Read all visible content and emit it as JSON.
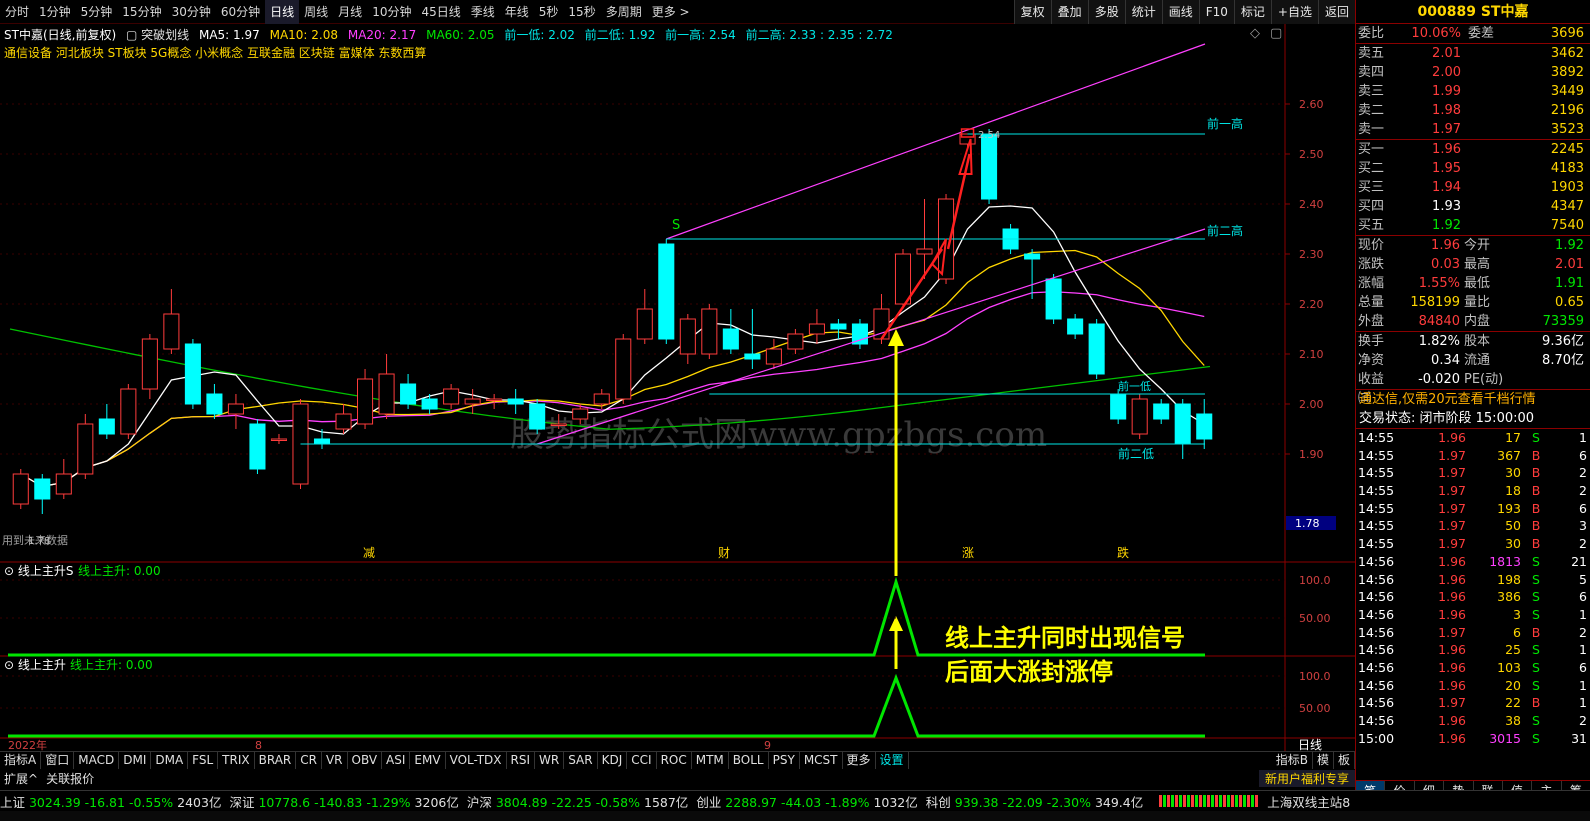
{
  "toolbar": {
    "periods": [
      "分时",
      "1分钟",
      "5分钟",
      "15分钟",
      "30分钟",
      "60分钟",
      "日线",
      "周线",
      "月线",
      "10分钟",
      "45日线",
      "季线",
      "年线",
      "5秒",
      "15秒",
      "多周期",
      "更多 >"
    ],
    "tools": [
      "复权",
      "叠加",
      "多股",
      "统计",
      "画线",
      "F10",
      "标记",
      "+自选",
      "返回"
    ]
  },
  "chart": {
    "header": {
      "name": "ST中嘉(日线,前复权)",
      "indicator": "突破划线",
      "ma5": "MA5: 1.97",
      "ma10": "MA10: 2.08",
      "ma20": "MA20: 2.17",
      "ma60": "MA60: 2.05",
      "ql1": "前一低: 2.02",
      "ql2": "前二低: 1.92",
      "qh1": "前一高: 2.54",
      "qh2": "前二高: 2.33 : 2.35 : 2.72"
    },
    "concepts": "通信设备 河北板块 ST板块 5G概念 小米概念 互联金融 区块链 富媒体 东数西算",
    "y_ticks": [
      "2.60",
      "2.50",
      "2.40",
      "2.30",
      "2.20",
      "2.10",
      "2.00",
      "1.90"
    ],
    "current_price_tag": "1.78",
    "line_labels": {
      "qh1": "前一高",
      "qh2": "前二高",
      "ql1": "前一低",
      "ql2": "前二低",
      "high_mark": "2.54",
      "low_mark": "1.78",
      "s_mark": "S"
    },
    "footnote": "用到未来数据",
    "markers": [
      "减",
      "财",
      "涨",
      "跌"
    ],
    "watermark": "股势指标公式网www.gpzbgs.com",
    "annotation_line1": "线上主升同时出现信号",
    "annotation_line2": "后面大涨封涨停",
    "sub1": {
      "title": "线上主升S",
      "value": "线上主升: 0.00",
      "ticks": [
        "100.0",
        "50.00"
      ]
    },
    "sub2": {
      "title": "线上主升",
      "value": "线上主升: 0.00",
      "ticks": [
        "100.0",
        "50.00"
      ]
    },
    "x_labels": [
      "2022年",
      "8",
      "9"
    ],
    "period_label": "日线"
  },
  "chart_data": {
    "type": "candlestick",
    "ylim": [
      1.78,
      2.72
    ],
    "candles": [
      {
        "o": 1.8,
        "c": 1.86,
        "h": 1.87,
        "l": 1.79
      },
      {
        "o": 1.85,
        "c": 1.81,
        "h": 1.86,
        "l": 1.78
      },
      {
        "o": 1.82,
        "c": 1.86,
        "h": 1.89,
        "l": 1.81
      },
      {
        "o": 1.86,
        "c": 1.96,
        "h": 1.98,
        "l": 1.85
      },
      {
        "o": 1.97,
        "c": 1.94,
        "h": 2.0,
        "l": 1.93
      },
      {
        "o": 1.94,
        "c": 2.03,
        "h": 2.04,
        "l": 1.93
      },
      {
        "o": 2.03,
        "c": 2.13,
        "h": 2.14,
        "l": 2.01
      },
      {
        "o": 2.11,
        "c": 2.18,
        "h": 2.23,
        "l": 2.1
      },
      {
        "o": 2.12,
        "c": 2.0,
        "h": 2.13,
        "l": 1.99
      },
      {
        "o": 2.02,
        "c": 1.98,
        "h": 2.04,
        "l": 1.97
      },
      {
        "o": 1.98,
        "c": 2.0,
        "h": 2.02,
        "l": 1.95
      },
      {
        "o": 1.96,
        "c": 1.87,
        "h": 1.97,
        "l": 1.86
      },
      {
        "o": 1.93,
        "c": 1.93,
        "h": 1.94,
        "l": 1.92
      },
      {
        "o": 1.84,
        "c": 2.0,
        "h": 2.01,
        "l": 1.83
      },
      {
        "o": 1.93,
        "c": 1.92,
        "h": 1.95,
        "l": 1.91
      },
      {
        "o": 1.95,
        "c": 1.98,
        "h": 2.0,
        "l": 1.94
      },
      {
        "o": 1.96,
        "c": 2.05,
        "h": 2.07,
        "l": 1.95
      },
      {
        "o": 1.98,
        "c": 2.06,
        "h": 2.1,
        "l": 1.97
      },
      {
        "o": 2.04,
        "c": 2.0,
        "h": 2.06,
        "l": 1.99
      },
      {
        "o": 2.01,
        "c": 1.99,
        "h": 2.02,
        "l": 1.98
      },
      {
        "o": 2.0,
        "c": 2.03,
        "h": 2.04,
        "l": 1.99
      },
      {
        "o": 2.0,
        "c": 2.01,
        "h": 2.03,
        "l": 1.98
      },
      {
        "o": 2.01,
        "c": 2.01,
        "h": 2.02,
        "l": 1.99
      },
      {
        "o": 2.01,
        "c": 2.0,
        "h": 2.03,
        "l": 1.98
      },
      {
        "o": 2.0,
        "c": 1.95,
        "h": 2.01,
        "l": 1.94
      },
      {
        "o": 1.96,
        "c": 1.96,
        "h": 1.98,
        "l": 1.95
      },
      {
        "o": 1.97,
        "c": 1.99,
        "h": 2.0,
        "l": 1.96
      },
      {
        "o": 2.0,
        "c": 2.02,
        "h": 2.03,
        "l": 1.99
      },
      {
        "o": 2.01,
        "c": 2.13,
        "h": 2.14,
        "l": 2.0
      },
      {
        "o": 2.13,
        "c": 2.19,
        "h": 2.23,
        "l": 2.12
      },
      {
        "o": 2.32,
        "c": 2.13,
        "h": 2.33,
        "l": 2.12
      },
      {
        "o": 2.1,
        "c": 2.17,
        "h": 2.18,
        "l": 2.08
      },
      {
        "o": 2.1,
        "c": 2.19,
        "h": 2.2,
        "l": 2.09
      },
      {
        "o": 2.15,
        "c": 2.11,
        "h": 2.19,
        "l": 2.1
      },
      {
        "o": 2.1,
        "c": 2.09,
        "h": 2.19,
        "l": 2.07
      },
      {
        "o": 2.08,
        "c": 2.11,
        "h": 2.13,
        "l": 2.07
      },
      {
        "o": 2.11,
        "c": 2.14,
        "h": 2.15,
        "l": 2.1
      },
      {
        "o": 2.14,
        "c": 2.16,
        "h": 2.19,
        "l": 2.12
      },
      {
        "o": 2.16,
        "c": 2.15,
        "h": 2.17,
        "l": 2.13
      },
      {
        "o": 2.16,
        "c": 2.12,
        "h": 2.17,
        "l": 2.11
      },
      {
        "o": 2.13,
        "c": 2.19,
        "h": 2.22,
        "l": 2.12
      },
      {
        "o": 2.2,
        "c": 2.3,
        "h": 2.31,
        "l": 2.19
      },
      {
        "o": 2.3,
        "c": 2.31,
        "h": 2.41,
        "l": 2.25
      },
      {
        "o": 2.25,
        "c": 2.41,
        "h": 2.42,
        "l": 2.24
      },
      {
        "o": 2.52,
        "c": 2.54,
        "h": 2.54,
        "l": 2.51
      },
      {
        "o": 2.54,
        "c": 2.41,
        "h": 2.55,
        "l": 2.4
      },
      {
        "o": 2.35,
        "c": 2.31,
        "h": 2.36,
        "l": 2.3
      },
      {
        "o": 2.3,
        "c": 2.29,
        "h": 2.31,
        "l": 2.21
      },
      {
        "o": 2.25,
        "c": 2.17,
        "h": 2.26,
        "l": 2.16
      },
      {
        "o": 2.17,
        "c": 2.14,
        "h": 2.18,
        "l": 2.13
      },
      {
        "o": 2.16,
        "c": 2.06,
        "h": 2.17,
        "l": 2.05
      },
      {
        "o": 2.02,
        "c": 1.97,
        "h": 2.03,
        "l": 1.96
      },
      {
        "o": 1.94,
        "c": 2.01,
        "h": 2.02,
        "l": 1.93
      },
      {
        "o": 2.0,
        "c": 1.97,
        "h": 2.01,
        "l": 1.96
      },
      {
        "o": 2.0,
        "c": 1.92,
        "h": 2.01,
        "l": 1.89
      },
      {
        "o": 1.98,
        "c": 1.93,
        "h": 2.01,
        "l": 1.91
      }
    ]
  },
  "quote": {
    "code": "000889",
    "name": "ST中嘉",
    "weibi_label": "委比",
    "weibi": "10.06%",
    "weicha_label": "委差",
    "weicha": "3696",
    "asks": [
      {
        "label": "卖五",
        "price": "2.01",
        "vol": "3462"
      },
      {
        "label": "卖四",
        "price": "2.00",
        "vol": "3892"
      },
      {
        "label": "卖三",
        "price": "1.99",
        "vol": "3449"
      },
      {
        "label": "卖二",
        "price": "1.98",
        "vol": "2196"
      },
      {
        "label": "卖一",
        "price": "1.97",
        "vol": "3523"
      }
    ],
    "bids": [
      {
        "label": "买一",
        "price": "1.96",
        "vol": "2245"
      },
      {
        "label": "买二",
        "price": "1.95",
        "vol": "4183"
      },
      {
        "label": "买三",
        "price": "1.94",
        "vol": "1903"
      },
      {
        "label": "买四",
        "price": "1.93",
        "vol": "4347"
      },
      {
        "label": "买五",
        "price": "1.92",
        "vol": "7540"
      }
    ],
    "fields1": [
      {
        "l": "现价",
        "a": "1.96",
        "l2": "今开",
        "b": "1.92"
      },
      {
        "l": "涨跌",
        "a": "0.03",
        "l2": "最高",
        "b": "2.01"
      },
      {
        "l": "涨幅",
        "a": "1.55%",
        "l2": "最低",
        "b": "1.91"
      },
      {
        "l": "总量",
        "a": "158199",
        "l2": "量比",
        "b": "0.65"
      },
      {
        "l": "外盘",
        "a": "84840",
        "l2": "内盘",
        "b": "73359"
      }
    ],
    "fields2": [
      {
        "l": "换手",
        "a": "1.82%",
        "l2": "股本",
        "b": "9.36亿"
      },
      {
        "l": "净资",
        "a": "0.34",
        "l2": "流通",
        "b": "8.70亿"
      },
      {
        "l": "收益㈢",
        "a": "-0.020",
        "l2": "PE(动)",
        "b": ""
      }
    ],
    "promo": "通达信,仅需20元查看千档行情",
    "trade_status": "交易状态: 闭市阶段 15:00:00",
    "ticks": [
      {
        "t": "14:55",
        "p": "1.96",
        "q": "17",
        "s": "S",
        "n": "1"
      },
      {
        "t": "14:55",
        "p": "1.97",
        "q": "367",
        "s": "B",
        "n": "6"
      },
      {
        "t": "14:55",
        "p": "1.97",
        "q": "30",
        "s": "B",
        "n": "2"
      },
      {
        "t": "14:55",
        "p": "1.97",
        "q": "18",
        "s": "B",
        "n": "2"
      },
      {
        "t": "14:55",
        "p": "1.97",
        "q": "193",
        "s": "B",
        "n": "6"
      },
      {
        "t": "14:55",
        "p": "1.97",
        "q": "50",
        "s": "B",
        "n": "3"
      },
      {
        "t": "14:55",
        "p": "1.97",
        "q": "30",
        "s": "B",
        "n": "2"
      },
      {
        "t": "14:56",
        "p": "1.96",
        "q": "1813",
        "s": "S",
        "n": "21"
      },
      {
        "t": "14:56",
        "p": "1.96",
        "q": "198",
        "s": "S",
        "n": "5"
      },
      {
        "t": "14:56",
        "p": "1.96",
        "q": "386",
        "s": "S",
        "n": "6"
      },
      {
        "t": "14:56",
        "p": "1.96",
        "q": "3",
        "s": "S",
        "n": "1"
      },
      {
        "t": "14:56",
        "p": "1.97",
        "q": "6",
        "s": "B",
        "n": "2"
      },
      {
        "t": "14:56",
        "p": "1.96",
        "q": "25",
        "s": "S",
        "n": "1"
      },
      {
        "t": "14:56",
        "p": "1.96",
        "q": "103",
        "s": "S",
        "n": "6"
      },
      {
        "t": "14:56",
        "p": "1.96",
        "q": "20",
        "s": "S",
        "n": "1"
      },
      {
        "t": "14:56",
        "p": "1.97",
        "q": "22",
        "s": "B",
        "n": "1"
      },
      {
        "t": "14:56",
        "p": "1.96",
        "q": "38",
        "s": "S",
        "n": "2"
      },
      {
        "t": "15:00",
        "p": "1.96",
        "q": "3015",
        "s": "S",
        "n": "31"
      }
    ],
    "tabs": [
      "笔",
      "价",
      "细",
      "势",
      "联",
      "值",
      "主",
      "筹"
    ]
  },
  "indicator_tabs": [
    "指标A",
    "窗口",
    "MACD",
    "DMI",
    "DMA",
    "FSL",
    "TRIX",
    "BRAR",
    "CR",
    "VR",
    "OBV",
    "ASI",
    "EMV",
    "VOL-TDX",
    "RSI",
    "WR",
    "SAR",
    "KDJ",
    "CCI",
    "ROC",
    "MTM",
    "BOLL",
    "PSY",
    "MCST",
    "更多",
    "设置"
  ],
  "ind_right": [
    "指标B",
    "模",
    "板"
  ],
  "ext_row": {
    "left1": "扩展^",
    "left2": "关联报价",
    "right": "新用户福利专享"
  },
  "status_bar": [
    {
      "name": "上证",
      "a": "3024.39",
      "b": "-16.81",
      "c": "-0.55%",
      "d": "2403亿"
    },
    {
      "name": "深证",
      "a": "10778.6",
      "b": "-140.83",
      "c": "-1.29%",
      "d": "3206亿"
    },
    {
      "name": "沪深",
      "a": "3804.89",
      "b": "-22.25",
      "c": "-0.58%",
      "d": "1587亿"
    },
    {
      "name": "创业",
      "a": "2288.97",
      "b": "-44.03",
      "c": "-1.89%",
      "d": "1032亿"
    },
    {
      "name": "科创",
      "a": "939.38",
      "b": "-22.09",
      "c": "-2.30%",
      "d": "349.4亿"
    }
  ],
  "server": "上海双线主站8",
  "colors": {
    "up": "#ff3c3c",
    "down": "#00ffff",
    "ma5": "#ffffff",
    "ma10": "#ffd700",
    "ma20": "#ff40ff",
    "ma60": "#00e600",
    "signal": "#ffff00"
  }
}
